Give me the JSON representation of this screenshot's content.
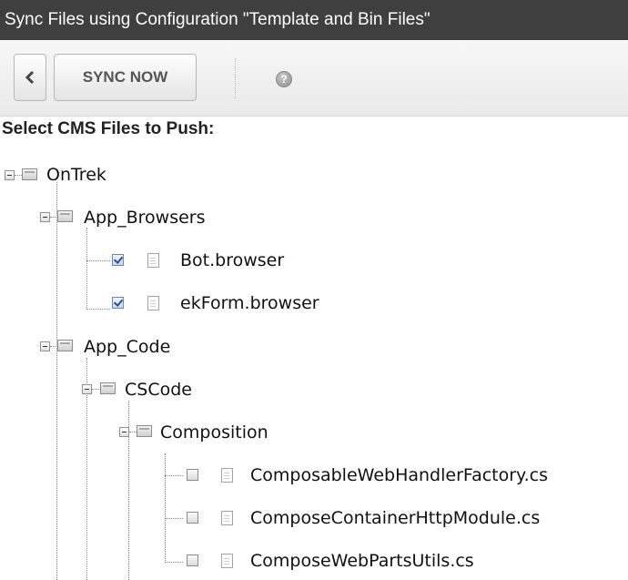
{
  "window": {
    "title": "Sync Files using Configuration \"Template and Bin Files\""
  },
  "toolbar": {
    "back_icon": "chevron-left-icon",
    "sync_label": "SYNC NOW",
    "help_icon": "help-icon",
    "help_glyph": "?"
  },
  "section": {
    "heading": "Select CMS Files to Push:"
  },
  "tree": {
    "root": {
      "label": "OnTrek",
      "children": {
        "app_browsers": {
          "label": "App_Browsers",
          "files": [
            {
              "label": "Bot.browser",
              "checked": true
            },
            {
              "label": "ekForm.browser",
              "checked": true
            }
          ]
        },
        "app_code": {
          "label": "App_Code",
          "cscode": {
            "label": "CSCode",
            "composition": {
              "label": "Composition",
              "files": [
                {
                  "label": "ComposableWebHandlerFactory.cs",
                  "checked": false
                },
                {
                  "label": "ComposeContainerHttpModule.cs",
                  "checked": false
                },
                {
                  "label": "ComposeWebPartsUtils.cs",
                  "checked": false
                }
              ]
            }
          }
        }
      }
    }
  },
  "colors": {
    "titlebar_bg": "#3f3f3f",
    "titlebar_fg": "#ffffff",
    "checkbox_check": "#2a4f9a"
  }
}
